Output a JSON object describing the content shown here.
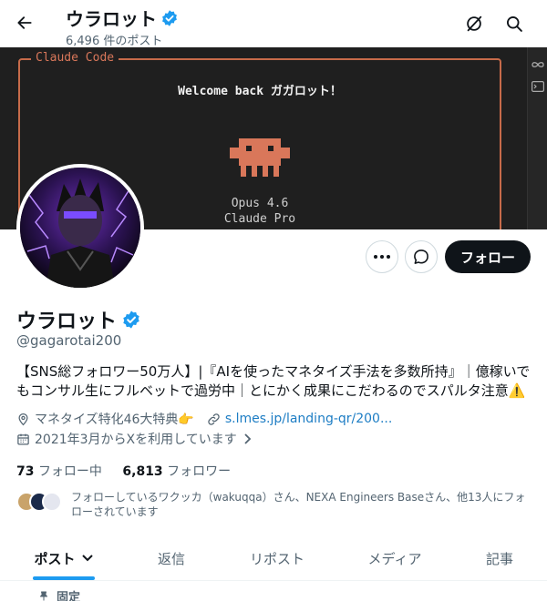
{
  "header": {
    "display_name": "ウラロット",
    "post_count": "6,496 件のポスト"
  },
  "banner": {
    "panel_label": "Claude Code",
    "welcome_text": "Welcome back ガガロット！",
    "model_line": "Opus 4.6",
    "plan_line": "Claude Pro",
    "colors": {
      "background": "#1f1f1f",
      "accent": "#d9775a"
    }
  },
  "actions": {
    "more_icon": "more-horizontal-icon",
    "message_icon": "message-bubble-icon",
    "follow_label": "フォロー"
  },
  "profile": {
    "display_name": "ウラロット",
    "handle": "@gagarotai200",
    "bio": "【SNS総フォロワー50万人】|『AIを使ったマネタイズ手法を多数所持』｜億稼いでもコンサル生にフルベットで過労中｜とにかく成果にこだわるのでスパルタ注意⚠️",
    "location": "マネタイズ特化46大特典👉",
    "website": "s.lmes.jp/landing-qr/200...",
    "joined": "2021年3月からXを利用しています",
    "following_count": "73",
    "following_label": "フォロー中",
    "followers_count": "6,813",
    "followers_label": "フォロワー",
    "known_followers": "フォローしているワクッカ（wakuqqa）さん、NEXA Engineers Baseさん、他13人にフォローされています"
  },
  "tabs": [
    {
      "label": "ポスト"
    },
    {
      "label": "返信"
    },
    {
      "label": "リポスト"
    },
    {
      "label": "メディア"
    },
    {
      "label": "記事"
    }
  ],
  "pinned": {
    "label": "固定"
  },
  "colors": {
    "verified": "#1d9bf0",
    "link": "#1d7dc4",
    "muted_text": "#536471",
    "tab_indicator": "#1d9bf0"
  }
}
